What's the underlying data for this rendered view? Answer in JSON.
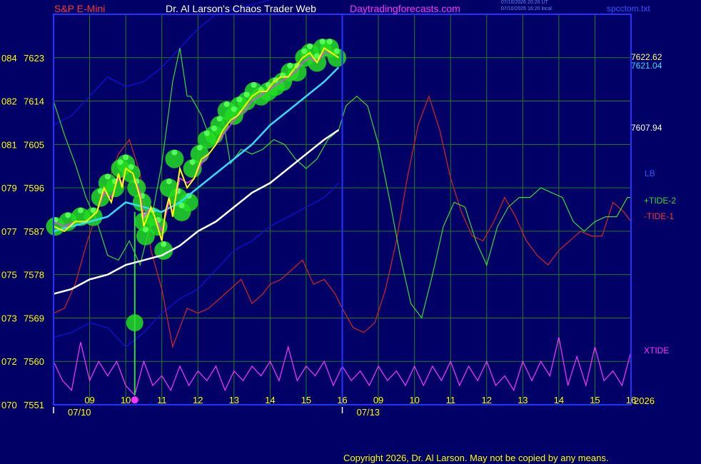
{
  "header": {
    "symbol": "S&P E-Mini",
    "site_title": "Dr. Al Larson's Chaos Trader Web",
    "site": "Daytradingforecasts.com",
    "stamp_ut": "07/10/2026 20:20 UT",
    "stamp_local": "07/10/2026 16:20 local",
    "file": "spcctom.txt"
  },
  "footer": {
    "copyright": "Copyright 2026, Dr. Al Larson. May not be copied by any means."
  },
  "colors": {
    "background": "#000066",
    "grid": "#1f7f1f",
    "frame": "#2233ff",
    "price": "#ffff00",
    "price_ema": "#ff33ff",
    "fast_ma": "#33ddff",
    "slow_ma": "#ffffff",
    "tide_plus": "#33dd33",
    "tide_minus": "#dd2222",
    "xtide": "#ff33ff",
    "band": "#1111dd",
    "bubble": "#22dd22"
  },
  "chart_data": {
    "type": "line",
    "title": "",
    "ylim": [
      7551,
      7632
    ],
    "xlim": [
      0,
      16
    ],
    "x_units": "hour index across two sessions (0-8 = 07/10 08:00-16:00, 8-16 = 07/13 08:00-16:00)",
    "y_ticks": [
      {
        "left": "084",
        "price": "7623",
        "value": 7623
      },
      {
        "left": "082",
        "price": "7614",
        "value": 7614
      },
      {
        "left": "081",
        "price": "7605",
        "value": 7605
      },
      {
        "left": "079",
        "price": "7596",
        "value": 7596
      },
      {
        "left": "077",
        "price": "7587",
        "value": 7587
      },
      {
        "left": "075",
        "price": "7578",
        "value": 7578
      },
      {
        "left": "073",
        "price": "7569",
        "value": 7569
      },
      {
        "left": "072",
        "price": "7560",
        "value": 7560
      },
      {
        "left": "070",
        "price": "7551",
        "value": 7551
      }
    ],
    "x_ticks": [
      {
        "label": "09",
        "x": 1
      },
      {
        "label": "10",
        "x": 2
      },
      {
        "label": "11",
        "x": 3
      },
      {
        "label": "12",
        "x": 4
      },
      {
        "label": "13",
        "x": 5
      },
      {
        "label": "14",
        "x": 6
      },
      {
        "label": "15",
        "x": 7
      },
      {
        "label": "16",
        "x": 8
      },
      {
        "label": "09",
        "x": 9
      },
      {
        "label": "10",
        "x": 10
      },
      {
        "label": "11",
        "x": 11
      },
      {
        "label": "12",
        "x": 12
      },
      {
        "label": "13",
        "x": 13
      },
      {
        "label": "14",
        "x": 14
      },
      {
        "label": "15",
        "x": 15
      },
      {
        "label": "16",
        "x": 16
      }
    ],
    "date_labels": [
      {
        "label": "07/10",
        "x": 0.5
      },
      {
        "label": "07/13",
        "x": 8.75
      }
    ],
    "year_label": "2026",
    "right_values": [
      {
        "label": "7622.62",
        "value": 7622.62,
        "color": "#ffff88"
      },
      {
        "label": "7621.04",
        "value": 7621.04,
        "color": "#33ddff"
      },
      {
        "label": "7607.94",
        "value": 7607.94,
        "color": "#ffffff"
      }
    ],
    "legend": [
      {
        "label": "LB",
        "color": "#3355ff",
        "value": 7597
      },
      {
        "label": "+TIDE-2",
        "color": "#33dd33",
        "value": 7594
      },
      {
        "label": "-TIDE-1",
        "color": "#ff3333",
        "value": 7591
      },
      {
        "label": "XTIDE",
        "color": "#ff33ff",
        "value": 7561
      }
    ],
    "series": [
      {
        "name": "price",
        "color": "#ffff00",
        "x": [
          0,
          0.3,
          0.6,
          0.9,
          1.2,
          1.4,
          1.6,
          1.8,
          1.9,
          2.0,
          2.2,
          2.4,
          2.5,
          2.7,
          2.8,
          3.0,
          3.1,
          3.2,
          3.3,
          3.5,
          3.7,
          3.9,
          4.1,
          4.3,
          4.5,
          4.7,
          4.9,
          5.1,
          5.3,
          5.5,
          5.7,
          5.9,
          6.1,
          6.3,
          6.5,
          6.7,
          6.9,
          7.1,
          7.3,
          7.5,
          7.7,
          7.9
        ],
        "y": [
          7588,
          7587,
          7589,
          7589,
          7591,
          7596,
          7593,
          7599,
          7596,
          7600,
          7599,
          7594,
          7588,
          7592,
          7590,
          7585,
          7591,
          7594,
          7590,
          7600,
          7596,
          7598,
          7602,
          7603,
          7605,
          7608,
          7610,
          7611,
          7613,
          7615,
          7616,
          7616,
          7618,
          7619,
          7619,
          7621,
          7623,
          7624,
          7622,
          7625,
          7624,
          7623
        ]
      },
      {
        "name": "price-ema",
        "color": "#ff33ff",
        "x": [
          0,
          0.3,
          0.6,
          0.9,
          1.2,
          1.4,
          1.6,
          1.8,
          1.9,
          2.0,
          2.2,
          2.4,
          2.5,
          2.7,
          2.8,
          3.0,
          3.1,
          3.2,
          3.3,
          3.5,
          3.7,
          3.9,
          4.1,
          4.3,
          4.5,
          4.7,
          4.9,
          5.1,
          5.3,
          5.5,
          5.7,
          5.9,
          6.1,
          6.3,
          6.5,
          6.7,
          6.9,
          7.1,
          7.3,
          7.5,
          7.7,
          7.9
        ],
        "y": [
          7589,
          7588,
          7589,
          7589,
          7591,
          7595,
          7594,
          7598,
          7597,
          7600,
          7599,
          7595,
          7590,
          7592,
          7590,
          7587,
          7590,
          7593,
          7591,
          7598,
          7597,
          7598,
          7601,
          7603,
          7605,
          7607,
          7609,
          7611,
          7612,
          7614,
          7615,
          7616,
          7617,
          7618,
          7619,
          7620,
          7622,
          7623,
          7622,
          7624,
          7624,
          7623
        ]
      },
      {
        "name": "fast-ma",
        "color": "#33ddff",
        "x": [
          0,
          0.5,
          1,
          1.5,
          2,
          2.5,
          3,
          3.5,
          4,
          4.5,
          5,
          5.5,
          6,
          6.5,
          7,
          7.5,
          7.9
        ],
        "y": [
          7587,
          7588,
          7589,
          7590,
          7593,
          7592,
          7591,
          7593,
          7596,
          7599,
          7602,
          7605,
          7609,
          7612,
          7615,
          7618,
          7621
        ]
      },
      {
        "name": "slow-ma",
        "color": "#ffffff",
        "x": [
          0,
          0.5,
          1,
          1.5,
          2,
          2.5,
          3,
          3.5,
          4,
          4.5,
          5,
          5.5,
          6,
          6.5,
          7,
          7.5,
          7.9
        ],
        "y": [
          7574,
          7575,
          7577,
          7578,
          7580,
          7581,
          7582,
          7584,
          7587,
          7589,
          7592,
          7595,
          7597,
          7600,
          7603,
          7606,
          7608
        ]
      },
      {
        "name": "upper-band",
        "color": "#1111dd",
        "x": [
          0,
          0.5,
          1,
          1.5,
          2,
          2.5,
          3,
          3.5,
          4,
          4.5,
          5,
          5.5,
          6,
          6.5,
          7,
          7.5,
          7.9
        ],
        "y": [
          7609,
          7611,
          7615,
          7619,
          7617,
          7618,
          7621,
          7625,
          7629,
          7632,
          7633,
          7634,
          7635,
          7636,
          7636,
          7636,
          7636
        ]
      },
      {
        "name": "lower-band",
        "color": "#1111dd",
        "x": [
          0,
          0.5,
          1,
          1.5,
          2,
          2.5,
          3,
          3.5,
          4,
          4.5,
          5,
          5.5,
          6,
          6.5,
          7,
          7.5,
          7.9
        ],
        "y": [
          7565,
          7566,
          7568,
          7567,
          7563,
          7566,
          7570,
          7573,
          7575,
          7579,
          7583,
          7585,
          7588,
          7590,
          7592,
          7594,
          7597
        ]
      },
      {
        "name": "+TIDE-2",
        "color": "#33dd33",
        "x": [
          0,
          0.3,
          0.6,
          0.9,
          1.2,
          1.5,
          1.8,
          2.1,
          2.4,
          2.7,
          3.0,
          3.3,
          3.5,
          3.7,
          3.8,
          4.1,
          4.4,
          4.7,
          4.9,
          5.2,
          5.5,
          5.8,
          6.1,
          6.4,
          6.7,
          7.0,
          7.3,
          7.6,
          7.9,
          8.1,
          8.4,
          8.7,
          9.0,
          9.3,
          9.6,
          9.9,
          10.2,
          10.5,
          10.8,
          11.1,
          11.4,
          11.7,
          12.0,
          12.3,
          12.6,
          12.9,
          13.2,
          13.5,
          13.8,
          14.1,
          14.4,
          14.7,
          15.0,
          15.3,
          15.6,
          15.9,
          16.0
        ],
        "y": [
          7614,
          7607,
          7601,
          7594,
          7589,
          7582,
          7581,
          7585,
          7580,
          7589,
          7601,
          7618,
          7625,
          7615,
          7615,
          7611,
          7605,
          7610,
          7601,
          7604,
          7603,
          7604,
          7606,
          7605,
          7602,
          7600,
          7602,
          7606,
          7608,
          7613,
          7615,
          7613,
          7605,
          7594,
          7582,
          7572,
          7569,
          7578,
          7588,
          7593,
          7592,
          7585,
          7580,
          7588,
          7592,
          7594,
          7594,
          7596,
          7595,
          7594,
          7589,
          7587,
          7589,
          7590,
          7590,
          7594,
          7594
        ]
      },
      {
        "name": "-TIDE-1",
        "color": "#dd2222",
        "x": [
          0,
          0.3,
          0.6,
          0.9,
          1.2,
          1.5,
          1.8,
          2.1,
          2.4,
          2.7,
          3.0,
          3.3,
          3.5,
          3.7,
          4.0,
          4.3,
          4.6,
          4.9,
          5.2,
          5.5,
          5.8,
          6.0,
          6.3,
          6.6,
          6.9,
          7.2,
          7.5,
          7.8,
          8.0,
          8.3,
          8.6,
          8.9,
          9.2,
          9.5,
          9.8,
          10.1,
          10.4,
          10.7,
          11.0,
          11.3,
          11.6,
          11.9,
          12.2,
          12.5,
          12.8,
          13.1,
          13.4,
          13.7,
          14.0,
          14.3,
          14.6,
          14.9,
          15.2,
          15.5,
          15.8,
          16.0
        ],
        "y": [
          7570,
          7571,
          7576,
          7584,
          7591,
          7597,
          7603,
          7606,
          7599,
          7583,
          7575,
          7563,
          7567,
          7571,
          7570,
          7571,
          7573,
          7575,
          7577,
          7572,
          7574,
          7576,
          7577,
          7579,
          7581,
          7576,
          7577,
          7574,
          7571,
          7567,
          7566,
          7568,
          7575,
          7585,
          7598,
          7609,
          7615,
          7608,
          7598,
          7591,
          7586,
          7585,
          7589,
          7594,
          7590,
          7585,
          7582,
          7580,
          7583,
          7585,
          7587,
          7586,
          7586,
          7593,
          7591,
          7589
        ]
      },
      {
        "name": "XTIDE",
        "color": "#ff33ff",
        "x": [
          0,
          0.25,
          0.5,
          0.75,
          1.0,
          1.25,
          1.5,
          1.75,
          2.0,
          2.25,
          2.5,
          2.75,
          3.0,
          3.25,
          3.5,
          3.75,
          4.0,
          4.25,
          4.5,
          4.75,
          5.0,
          5.25,
          5.5,
          5.75,
          6.0,
          6.25,
          6.5,
          6.75,
          7.0,
          7.25,
          7.5,
          7.75,
          8.0,
          8.25,
          8.5,
          8.75,
          9.0,
          9.25,
          9.5,
          9.75,
          10.0,
          10.25,
          10.5,
          10.75,
          11.0,
          11.25,
          11.5,
          11.75,
          12.0,
          12.25,
          12.5,
          12.75,
          13.0,
          13.25,
          13.5,
          13.75,
          14.0,
          14.25,
          14.5,
          14.75,
          15.0,
          15.25,
          15.5,
          15.75,
          16.0
        ],
        "y": [
          7560,
          7556,
          7554,
          7564,
          7556,
          7560,
          7557,
          7560,
          7555,
          7553,
          7560,
          7555,
          7557,
          7554,
          7559,
          7555,
          7558,
          7556,
          7559,
          7554,
          7558,
          7556,
          7559,
          7557,
          7560,
          7556,
          7563,
          7556,
          7559,
          7557,
          7560,
          7555,
          7559,
          7556,
          7558,
          7555,
          7559,
          7556,
          7558,
          7555,
          7559,
          7555,
          7559,
          7556,
          7560,
          7555,
          7559,
          7556,
          7560,
          7555,
          7557,
          7554,
          7560,
          7556,
          7560,
          7557,
          7565,
          7555,
          7561,
          7555,
          7563,
          7556,
          7558,
          7555,
          7562
        ]
      }
    ],
    "bubbles": [
      {
        "x": 0.05,
        "y": 7588
      },
      {
        "x": 0.4,
        "y": 7589
      },
      {
        "x": 0.75,
        "y": 7590
      },
      {
        "x": 1.1,
        "y": 7590
      },
      {
        "x": 1.3,
        "y": 7594
      },
      {
        "x": 1.5,
        "y": 7597
      },
      {
        "x": 1.7,
        "y": 7596
      },
      {
        "x": 1.85,
        "y": 7600
      },
      {
        "x": 2.0,
        "y": 7601
      },
      {
        "x": 2.15,
        "y": 7599
      },
      {
        "x": 2.3,
        "y": 7596
      },
      {
        "x": 2.45,
        "y": 7593
      },
      {
        "x": 2.5,
        "y": 7589
      },
      {
        "x": 2.55,
        "y": 7586
      },
      {
        "x": 2.75,
        "y": 7590
      },
      {
        "x": 2.9,
        "y": 7588
      },
      {
        "x": 3.05,
        "y": 7583
      },
      {
        "x": 3.2,
        "y": 7596
      },
      {
        "x": 3.35,
        "y": 7602
      },
      {
        "x": 3.45,
        "y": 7594
      },
      {
        "x": 3.55,
        "y": 7591
      },
      {
        "x": 3.75,
        "y": 7593
      },
      {
        "x": 3.85,
        "y": 7600
      },
      {
        "x": 4.05,
        "y": 7603
      },
      {
        "x": 4.25,
        "y": 7606
      },
      {
        "x": 4.45,
        "y": 7607
      },
      {
        "x": 4.6,
        "y": 7609
      },
      {
        "x": 4.8,
        "y": 7612
      },
      {
        "x": 5.0,
        "y": 7611
      },
      {
        "x": 5.15,
        "y": 7613
      },
      {
        "x": 5.35,
        "y": 7614
      },
      {
        "x": 5.55,
        "y": 7616
      },
      {
        "x": 5.75,
        "y": 7615
      },
      {
        "x": 5.95,
        "y": 7616
      },
      {
        "x": 6.15,
        "y": 7617
      },
      {
        "x": 6.35,
        "y": 7618
      },
      {
        "x": 6.55,
        "y": 7620
      },
      {
        "x": 6.75,
        "y": 7620
      },
      {
        "x": 6.95,
        "y": 7623
      },
      {
        "x": 7.1,
        "y": 7624
      },
      {
        "x": 7.3,
        "y": 7622
      },
      {
        "x": 7.45,
        "y": 7625
      },
      {
        "x": 7.65,
        "y": 7625
      },
      {
        "x": 7.85,
        "y": 7623
      },
      {
        "x": 2.25,
        "y": 7568
      }
    ],
    "marker": {
      "x": 2.25,
      "y": 7552,
      "color": "#ff33ff"
    },
    "spike": {
      "x": 2.25,
      "y_from": 7591,
      "y_to": 7553,
      "color": "#33dd33"
    }
  }
}
